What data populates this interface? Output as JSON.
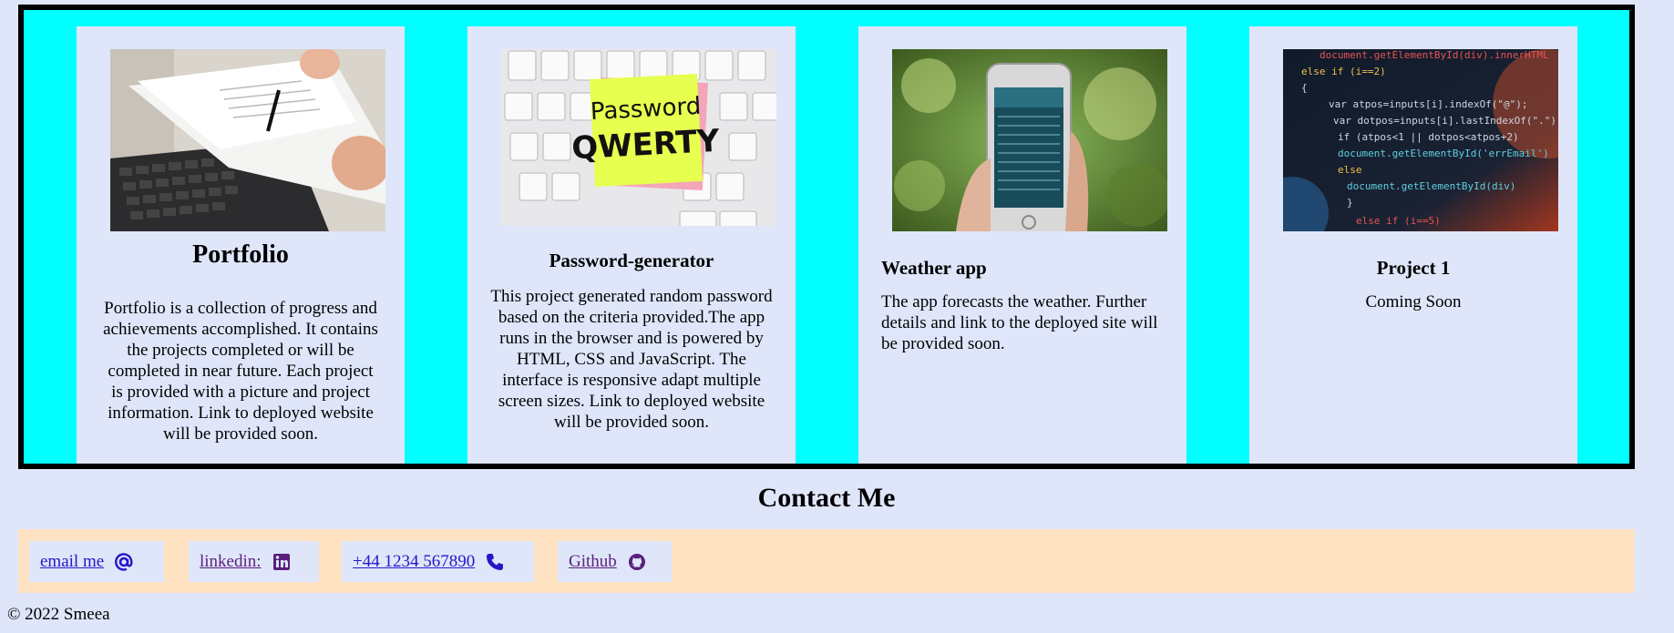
{
  "projects": [
    {
      "title": "Portfolio",
      "description": "Portfolio is a collection of progress and achievements accomplished. It contains the projects completed or will be completed in near future. Each project is provided with a picture and project information. Link to deployed website will be provided soon.",
      "image_icon": "document-signing-photo"
    },
    {
      "title": "Password-generator",
      "description": "This project generated random password based on the criteria provided.The app runs in the browser and is powered by HTML, CSS and JavaScript. The interface is responsive adapt multiple screen sizes. Link to deployed website will be provided soon.",
      "image_icon": "keyboard-sticky-note-photo",
      "sticky_line1": "Password",
      "sticky_line2": "QWERTY"
    },
    {
      "title": "Weather app",
      "description": "The app forecasts the weather. Further details and link to the deployed site will be provided soon.",
      "image_icon": "phone-weather-photo"
    },
    {
      "title": "Project 1",
      "description": "Coming Soon",
      "image_icon": "code-screen-photo"
    }
  ],
  "contact": {
    "title": "Contact Me",
    "links": [
      {
        "label": "email me ",
        "icon": "at-sign-icon"
      },
      {
        "label": "linkedin: ",
        "icon": "linkedin-icon"
      },
      {
        "label": "+44 1234 567890",
        "icon": "phone-icon"
      },
      {
        "label": "Github",
        "icon": "github-icon"
      }
    ]
  },
  "footer": {
    "text": "© 2022 Smeea"
  },
  "colors": {
    "page_bg": "#dfe6fa",
    "projects_bg": "#00ffff",
    "contact_bar_bg": "#ffe2c2",
    "link": "#2417c9",
    "visited_link": "#5a1f7a"
  }
}
